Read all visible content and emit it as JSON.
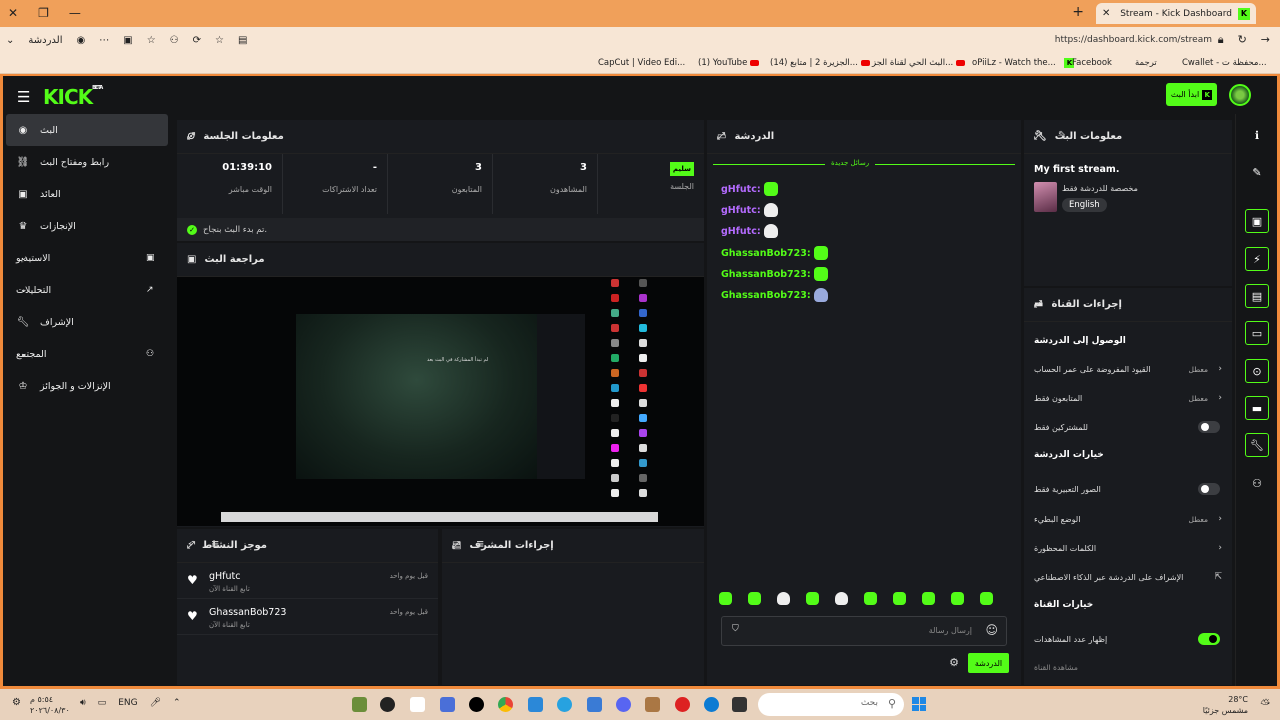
{
  "browser": {
    "tab_title": "Stream - Kick Dashboard",
    "url": "https://dashboard.kick.com/stream",
    "left_label": "الدردشة",
    "bookmarks": [
      {
        "label": "CapCut | Video Edi..."
      },
      {
        "label": "(1) YouTube"
      },
      {
        "label": "(14) الجزيرة 2 | متابع..."
      },
      {
        "label": "البث الحي لقناة الجز..."
      },
      {
        "label": "oPiiLz - Watch the..."
      },
      {
        "label": "Facebook"
      },
      {
        "label": "ترجمة"
      },
      {
        "label": "Cwallet - محفظة ت..."
      }
    ]
  },
  "topbar": {
    "logo": "KICK",
    "logo_badge": "BETA",
    "go_live": "ابدأ البث"
  },
  "nav": [
    {
      "label": "البث",
      "icon": "broadcast-icon",
      "active": true
    },
    {
      "label": "رابط ومفتاح البث",
      "icon": "link-icon"
    },
    {
      "label": "العائد",
      "icon": "wallet-icon"
    },
    {
      "label": "الإنجازات",
      "icon": "trophy-icon"
    },
    {
      "label": "الاستيديو",
      "icon": "studio-icon",
      "expandable": true
    },
    {
      "label": "التحليلات",
      "icon": "analytics-icon",
      "expandable": true
    },
    {
      "label": "الإشراف",
      "icon": "wrench-icon"
    },
    {
      "label": "المجتمع",
      "icon": "community-icon",
      "expandable": true
    },
    {
      "label": "الإنزالات و الجوائز",
      "icon": "gift-icon"
    }
  ],
  "session": {
    "title": "معلومات الجلسة",
    "stats": [
      {
        "value": "01:39:10",
        "label": "الوقت مباشر"
      },
      {
        "value": "-",
        "label": "تعداد الاشتراكات"
      },
      {
        "value": "3",
        "label": "المتابعون"
      },
      {
        "value": "3",
        "label": "المشاهدون"
      },
      {
        "value": "سليم",
        "label": "الجلسة"
      }
    ],
    "status_message": "تم بدء البث بنجاح."
  },
  "preview": {
    "title": "مراجعة البث",
    "overlay_text": "لم تبدأ المشاركة في البث بعد"
  },
  "activity": {
    "title": "موجز النشاط",
    "items": [
      {
        "name": "gHfutc",
        "sub": "تابع القناة الآن",
        "time": "قبل يوم واحد"
      },
      {
        "name": "GhassanBob723",
        "sub": "تابع القناة الآن",
        "time": "قبل يوم واحد"
      }
    ]
  },
  "mod_actions": {
    "title": "إجراءات المشرف"
  },
  "chat": {
    "title": "الدردشة",
    "new_messages": "رسائل جديدة",
    "messages": [
      {
        "user": "gHfutc:",
        "color": "#b46bff"
      },
      {
        "user": "gHfutc:",
        "color": "#b46bff"
      },
      {
        "user": "gHfutc:",
        "color": "#b46bff"
      },
      {
        "user": "GhassanBob723:",
        "color": "#53fc18"
      },
      {
        "user": "GhassanBob723:",
        "color": "#53fc18"
      },
      {
        "user": "GhassanBob723:",
        "color": "#53fc18"
      }
    ],
    "input_placeholder": "إرسال رسالة",
    "send_label": "الدردشة"
  },
  "stream_info": {
    "title": "معلومات البث",
    "stream_title": "My first stream.",
    "category": "مخصصة للدردشة فقط",
    "language": "English"
  },
  "channel_actions": {
    "title": "إجراءات القناة",
    "chat_access": "الوصول إلى الدردشة",
    "account_age": "القيود المفروضة على عمر الحساب",
    "account_age_val": "معطل",
    "followers_only": "المتابعون فقط",
    "followers_only_val": "معطل",
    "subs_only": "للمشتركين فقط",
    "chat_options": "خيارات الدردشة",
    "emotes_only": "الصور التعبيرية فقط",
    "slow_mode": "الوضع البطيء",
    "slow_mode_val": "معطل",
    "banned_words": "الكلمات المحظورة",
    "ai_mod": "الإشراف على الدردشة عبر الذكاء الاصطناعي",
    "channel_options": "خيارات القناة",
    "show_viewers": "إظهار عدد المشاهدات",
    "watch_channel": "مشاهدة القناة"
  },
  "taskbar": {
    "search": "بحث",
    "lang": "ENG",
    "time": "٥:٥٤ م",
    "date": "٢٠٢٦/٠٨/٣٠",
    "temp": "28°C",
    "weather": "مشمس جزئيًا"
  },
  "colors": {
    "accent": "#53fc18",
    "bg": "#141517",
    "panel": "#191b1f"
  }
}
